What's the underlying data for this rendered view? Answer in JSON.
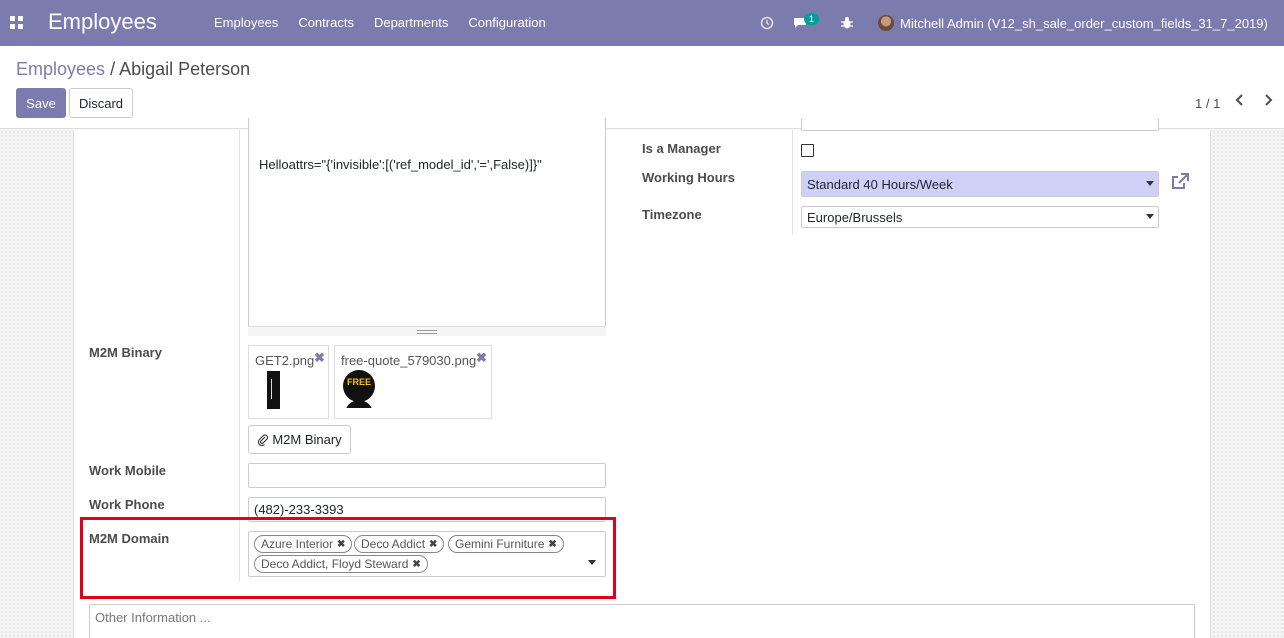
{
  "navbar": {
    "brand": "Employees",
    "menu": [
      "Employees",
      "Contracts",
      "Departments",
      "Configuration"
    ],
    "chat_badge": "1",
    "user_name": "Mitchell Admin (V12_sh_sale_order_custom_fields_31_7_2019)",
    "color": "#7c7bad"
  },
  "breadcrumb": {
    "parent": "Employees",
    "separator": "/",
    "current": "Abigail Peterson"
  },
  "buttons": {
    "save": "Save",
    "discard": "Discard"
  },
  "pager": {
    "text": "1 / 1"
  },
  "editor": {
    "content": "Helloattrs=\"{'invisible':[('ref_model_id','=',False)]}\""
  },
  "m2m_binary": {
    "label": "M2M Binary",
    "files": [
      {
        "name": "GET2.png"
      },
      {
        "name": "free-quote_579030.png",
        "thumb_text": "FREE"
      }
    ],
    "upload_button": "M2M Binary"
  },
  "work_mobile": {
    "label": "Work Mobile",
    "value": ""
  },
  "work_phone": {
    "label": "Work Phone",
    "value": "(482)-233-3393"
  },
  "m2m_domain": {
    "label": "M2M Domain",
    "tags": [
      "Azure Interior",
      "Deco Addict",
      "Gemini Furniture",
      "Deco Addict, Floyd Steward"
    ]
  },
  "other_info": {
    "placeholder": "Other Information ..."
  },
  "right": {
    "is_manager": {
      "label": "Is a Manager",
      "checked": false
    },
    "working_hours": {
      "label": "Working Hours",
      "value": "Standard 40 Hours/Week"
    },
    "timezone": {
      "label": "Timezone",
      "value": "Europe/Brussels"
    }
  },
  "colors": {
    "accent": "#7c7bad",
    "highlight": "#e0001a",
    "selected_field": "#cfd0f8"
  }
}
